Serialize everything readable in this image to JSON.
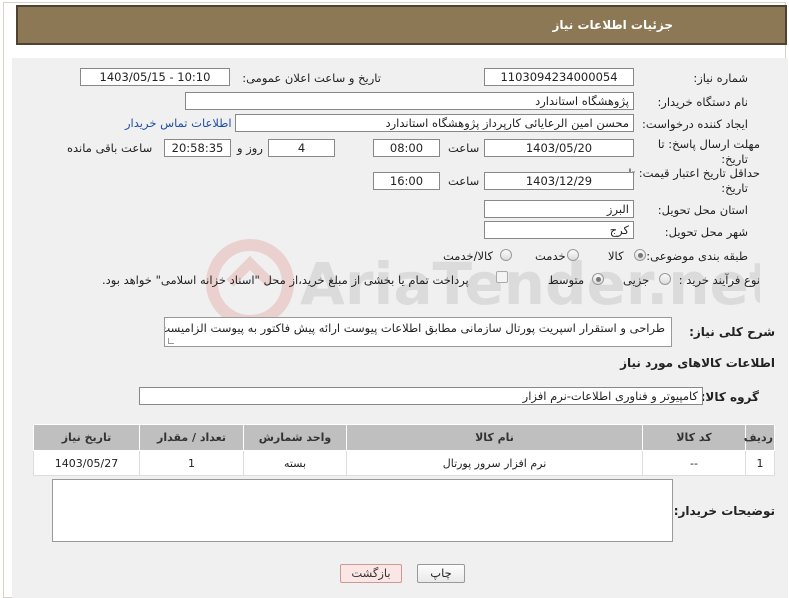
{
  "header": {
    "title": "جزئیات اطلاعات نیاز"
  },
  "form": {
    "need_number_label": "شماره نیاز:",
    "need_number": "1103094234000054",
    "announce_label": "تاریخ و ساعت اعلان عمومی:",
    "announce_value": "1403/05/15 - 10:10",
    "buyer_org_label": "نام دستگاه خریدار:",
    "buyer_org": "پژوهشگاه استاندارد",
    "creator_label": "ایجاد کننده درخواست:",
    "creator": "محسن امین الرعایائی کارپرداز پژوهشگاه استاندارد",
    "contact_link": "اطلاعات تماس خریدار",
    "deadline_label_1": "مهلت ارسال پاسخ: تا",
    "deadline_label_2": "تاریخ:",
    "deadline_date": "1403/05/20",
    "time_label": "ساعت",
    "deadline_time": "08:00",
    "days_value": "4",
    "days_label": "روز و",
    "remaining_time": "20:58:35",
    "remaining_label": "ساعت باقی مانده",
    "validity_label_1": "حداقل تاریخ اعتبار قیمت: تا",
    "validity_label_2": "تاریخ:",
    "validity_date": "1403/12/29",
    "validity_time_label": "ساعت",
    "validity_time": "16:00",
    "province_label": "استان محل تحویل:",
    "province": "البرز",
    "city_label": "شهر محل تحویل:",
    "city": "کرج",
    "category_label": "طبقه بندی موضوعی:",
    "category_options": [
      "کالا",
      "خدمت",
      "کالا/خدمت"
    ],
    "category_selected": "کالا",
    "process_label": "نوع فرآیند خرید :",
    "process_options": [
      "جزیی",
      "متوسط"
    ],
    "process_selected": "متوسط",
    "payment_note": "پرداخت تمام یا بخشی از مبلغ خرید،از محل \"اسناد خزانه اسلامی\" خواهد بود."
  },
  "description": {
    "label": "شرح کلی نیاز:",
    "text": "طراحی و استقرار اسپریت پورتال سازمانی مطابق اطلاعات پیوست ارائه پیش فاکتور به پیوست الزامیست"
  },
  "goods": {
    "section_title": "اطلاعات کالاهای مورد نیاز",
    "group_label": "گروه کالا:",
    "group_value": "کامپیوتر و فناوری اطلاعات-نرم افزار",
    "columns": [
      "ردیف",
      "کد کالا",
      "نام کالا",
      "واحد شمارش",
      "تعداد / مقدار",
      "تاریخ نیاز"
    ],
    "rows": [
      {
        "row": "1",
        "code": "--",
        "name": "نرم افزار سرور پورتال",
        "unit": "بسته",
        "qty": "1",
        "date": "1403/05/27"
      }
    ]
  },
  "notes": {
    "label": "توضیحات خریدار:"
  },
  "buttons": {
    "print": "چاپ",
    "back": "بازگشت"
  },
  "watermark": {
    "text": "AriaTender.net"
  },
  "colors": {
    "header_bg": "#8c7855",
    "panel_bg": "#f0f0f0",
    "link": "#1f4ea6",
    "table_header": "#bfbfbf"
  }
}
